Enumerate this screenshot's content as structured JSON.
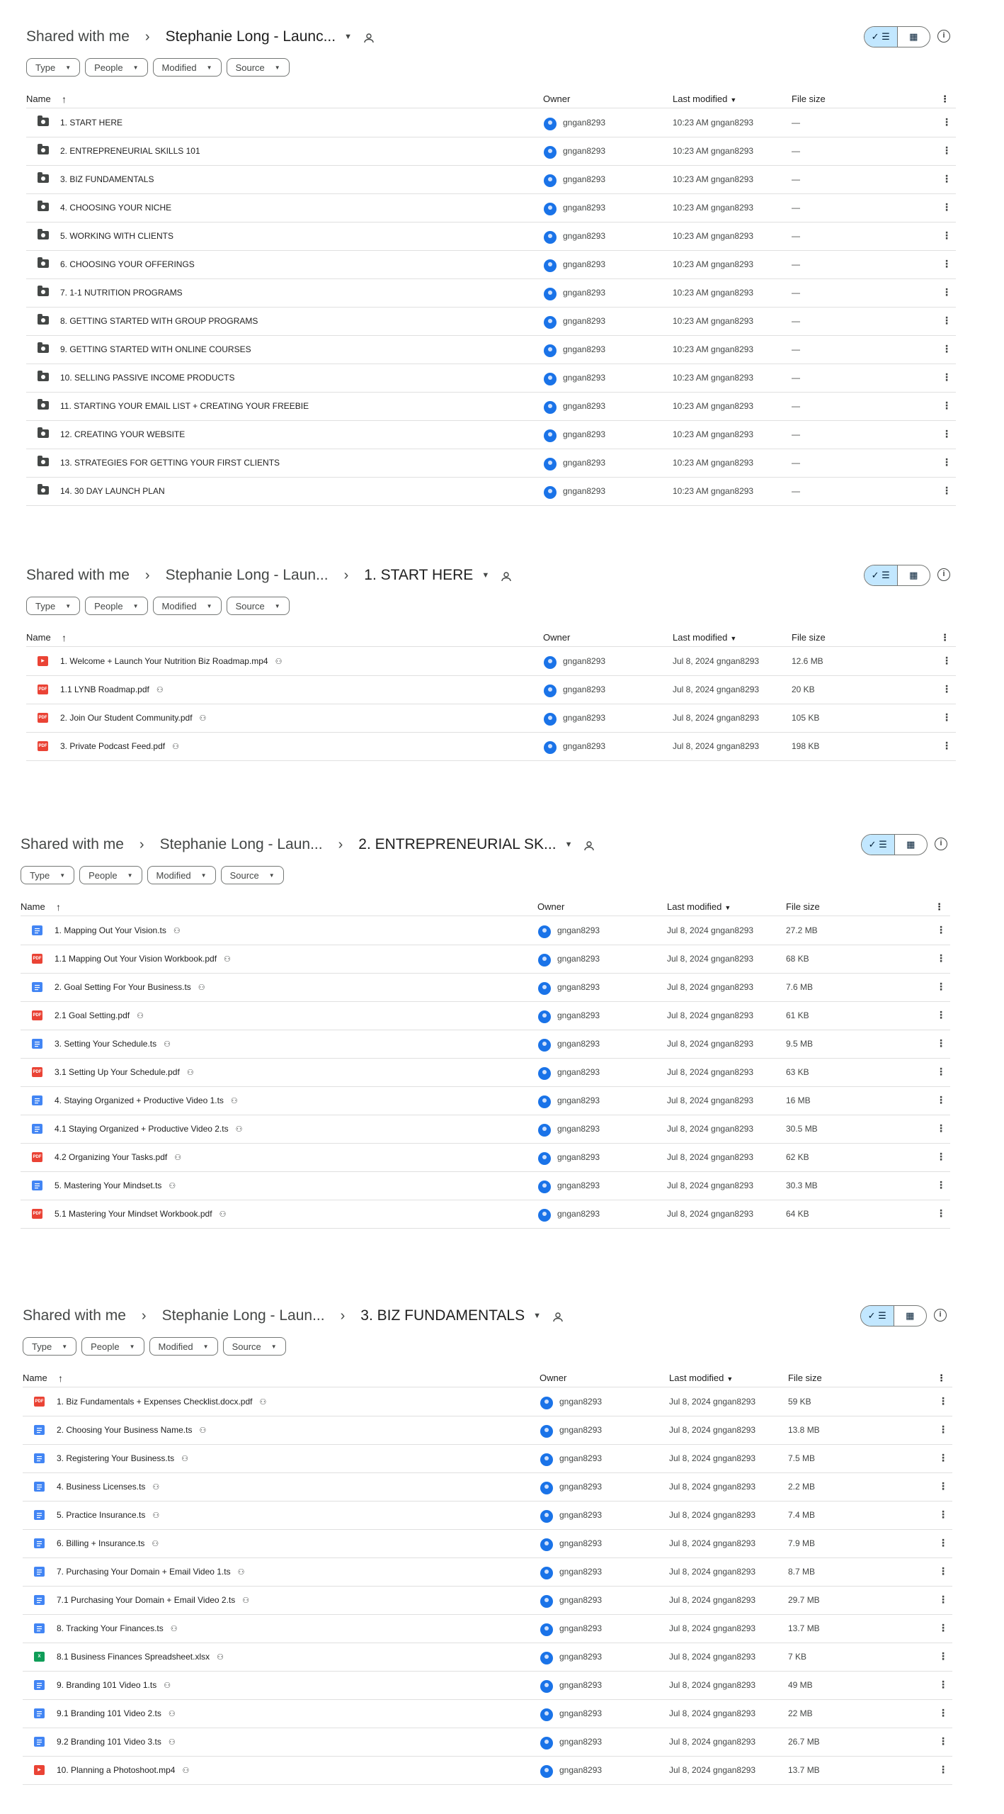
{
  "colors": {
    "accent": "#c2e7ff",
    "avatar": "#1a73e8",
    "pdf": "#ea4335",
    "video": "#ea4335",
    "doc": "#4285f4",
    "sheet": "#0f9d58",
    "folder": "#444746"
  },
  "columns": {
    "name": "Name",
    "owner": "Owner",
    "modified": "Last modified",
    "size": "File size"
  },
  "filters": [
    "Type",
    "People",
    "Modified",
    "Source"
  ],
  "panels": [
    {
      "crumbs": [
        "Shared with me",
        "Stephanie Long - Launc..."
      ],
      "rows": [
        {
          "name": "1. START HERE",
          "icon": "folder",
          "owner": "gngan8293",
          "modified": "10:23 AM gngan8293",
          "size": "—",
          "shared": false
        },
        {
          "name": "2. ENTREPRENEURIAL SKILLS 101",
          "icon": "folder",
          "owner": "gngan8293",
          "modified": "10:23 AM gngan8293",
          "size": "—",
          "shared": false
        },
        {
          "name": "3. BIZ FUNDAMENTALS",
          "icon": "folder",
          "owner": "gngan8293",
          "modified": "10:23 AM gngan8293",
          "size": "—",
          "shared": false
        },
        {
          "name": "4. CHOOSING YOUR NICHE",
          "icon": "folder",
          "owner": "gngan8293",
          "modified": "10:23 AM gngan8293",
          "size": "—",
          "shared": false
        },
        {
          "name": "5. WORKING WITH CLIENTS",
          "icon": "folder",
          "owner": "gngan8293",
          "modified": "10:23 AM gngan8293",
          "size": "—",
          "shared": false
        },
        {
          "name": "6. CHOOSING YOUR OFFERINGS",
          "icon": "folder",
          "owner": "gngan8293",
          "modified": "10:23 AM gngan8293",
          "size": "—",
          "shared": false
        },
        {
          "name": "7. 1-1 NUTRITION PROGRAMS",
          "icon": "folder",
          "owner": "gngan8293",
          "modified": "10:23 AM gngan8293",
          "size": "—",
          "shared": false
        },
        {
          "name": "8. GETTING STARTED WITH GROUP PROGRAMS",
          "icon": "folder",
          "owner": "gngan8293",
          "modified": "10:23 AM gngan8293",
          "size": "—",
          "shared": false
        },
        {
          "name": "9. GETTING STARTED WITH ONLINE COURSES",
          "icon": "folder",
          "owner": "gngan8293",
          "modified": "10:23 AM gngan8293",
          "size": "—",
          "shared": false
        },
        {
          "name": "10. SELLING PASSIVE INCOME PRODUCTS",
          "icon": "folder",
          "owner": "gngan8293",
          "modified": "10:23 AM gngan8293",
          "size": "—",
          "shared": false
        },
        {
          "name": "11. STARTING YOUR EMAIL LIST + CREATING YOUR FREEBIE",
          "icon": "folder",
          "owner": "gngan8293",
          "modified": "10:23 AM gngan8293",
          "size": "—",
          "shared": false
        },
        {
          "name": "12. CREATING YOUR WEBSITE",
          "icon": "folder",
          "owner": "gngan8293",
          "modified": "10:23 AM gngan8293",
          "size": "—",
          "shared": false
        },
        {
          "name": "13. STRATEGIES FOR GETTING YOUR FIRST CLIENTS",
          "icon": "folder",
          "owner": "gngan8293",
          "modified": "10:23 AM gngan8293",
          "size": "—",
          "shared": false
        },
        {
          "name": "14. 30 DAY LAUNCH PLAN",
          "icon": "folder",
          "owner": "gngan8293",
          "modified": "10:23 AM gngan8293",
          "size": "—",
          "shared": false
        }
      ]
    },
    {
      "crumbs": [
        "Shared with me",
        "Stephanie Long - Laun...",
        "1. START HERE"
      ],
      "rows": [
        {
          "name": "1. Welcome + Launch Your Nutrition Biz Roadmap.mp4",
          "icon": "video",
          "owner": "gngan8293",
          "modified": "Jul 8, 2024 gngan8293",
          "size": "12.6 MB",
          "shared": true
        },
        {
          "name": "1.1 LYNB Roadmap.pdf",
          "icon": "pdf",
          "owner": "gngan8293",
          "modified": "Jul 8, 2024 gngan8293",
          "size": "20 KB",
          "shared": true
        },
        {
          "name": "2. Join Our Student Community.pdf",
          "icon": "pdf",
          "owner": "gngan8293",
          "modified": "Jul 8, 2024 gngan8293",
          "size": "105 KB",
          "shared": true
        },
        {
          "name": "3. Private Podcast Feed.pdf",
          "icon": "pdf",
          "owner": "gngan8293",
          "modified": "Jul 8, 2024 gngan8293",
          "size": "198 KB",
          "shared": true
        }
      ]
    },
    {
      "crumbs": [
        "Shared with me",
        "Stephanie Long - Laun...",
        "2. ENTREPRENEURIAL SK..."
      ],
      "rows": [
        {
          "name": "1. Mapping Out Your Vision.ts",
          "icon": "doc",
          "owner": "gngan8293",
          "modified": "Jul 8, 2024 gngan8293",
          "size": "27.2 MB",
          "shared": true
        },
        {
          "name": "1.1 Mapping Out Your Vision Workbook.pdf",
          "icon": "pdf",
          "owner": "gngan8293",
          "modified": "Jul 8, 2024 gngan8293",
          "size": "68 KB",
          "shared": true
        },
        {
          "name": "2. Goal Setting For Your Business.ts",
          "icon": "doc",
          "owner": "gngan8293",
          "modified": "Jul 8, 2024 gngan8293",
          "size": "7.6 MB",
          "shared": true
        },
        {
          "name": "2.1 Goal Setting.pdf",
          "icon": "pdf",
          "owner": "gngan8293",
          "modified": "Jul 8, 2024 gngan8293",
          "size": "61 KB",
          "shared": true
        },
        {
          "name": "3. Setting Your Schedule.ts",
          "icon": "doc",
          "owner": "gngan8293",
          "modified": "Jul 8, 2024 gngan8293",
          "size": "9.5 MB",
          "shared": true
        },
        {
          "name": "3.1 Setting Up Your Schedule.pdf",
          "icon": "pdf",
          "owner": "gngan8293",
          "modified": "Jul 8, 2024 gngan8293",
          "size": "63 KB",
          "shared": true
        },
        {
          "name": "4. Staying Organized + Productive Video 1.ts",
          "icon": "doc",
          "owner": "gngan8293",
          "modified": "Jul 8, 2024 gngan8293",
          "size": "16 MB",
          "shared": true
        },
        {
          "name": "4.1 Staying Organized + Productive Video 2.ts",
          "icon": "doc",
          "owner": "gngan8293",
          "modified": "Jul 8, 2024 gngan8293",
          "size": "30.5 MB",
          "shared": true
        },
        {
          "name": "4.2 Organizing Your Tasks.pdf",
          "icon": "pdf",
          "owner": "gngan8293",
          "modified": "Jul 8, 2024 gngan8293",
          "size": "62 KB",
          "shared": true
        },
        {
          "name": "5. Mastering Your Mindset.ts",
          "icon": "doc",
          "owner": "gngan8293",
          "modified": "Jul 8, 2024 gngan8293",
          "size": "30.3 MB",
          "shared": true
        },
        {
          "name": "5.1 Mastering Your Mindset Workbook.pdf",
          "icon": "pdf",
          "owner": "gngan8293",
          "modified": "Jul 8, 2024 gngan8293",
          "size": "64 KB",
          "shared": true
        }
      ]
    },
    {
      "crumbs": [
        "Shared with me",
        "Stephanie Long - Laun...",
        "3. BIZ FUNDAMENTALS"
      ],
      "rows": [
        {
          "name": "1. Biz Fundamentals + Expenses Checklist.docx.pdf",
          "icon": "pdf",
          "owner": "gngan8293",
          "modified": "Jul 8, 2024 gngan8293",
          "size": "59 KB",
          "shared": true
        },
        {
          "name": "2. Choosing Your Business Name.ts",
          "icon": "doc",
          "owner": "gngan8293",
          "modified": "Jul 8, 2024 gngan8293",
          "size": "13.8 MB",
          "shared": true
        },
        {
          "name": "3. Registering Your Business.ts",
          "icon": "doc",
          "owner": "gngan8293",
          "modified": "Jul 8, 2024 gngan8293",
          "size": "7.5 MB",
          "shared": true
        },
        {
          "name": "4. Business Licenses.ts",
          "icon": "doc",
          "owner": "gngan8293",
          "modified": "Jul 8, 2024 gngan8293",
          "size": "2.2 MB",
          "shared": true
        },
        {
          "name": "5. Practice Insurance.ts",
          "icon": "doc",
          "owner": "gngan8293",
          "modified": "Jul 8, 2024 gngan8293",
          "size": "7.4 MB",
          "shared": true
        },
        {
          "name": "6. Billing + Insurance.ts",
          "icon": "doc",
          "owner": "gngan8293",
          "modified": "Jul 8, 2024 gngan8293",
          "size": "7.9 MB",
          "shared": true
        },
        {
          "name": "7. Purchasing Your Domain + Email Video 1.ts",
          "icon": "doc",
          "owner": "gngan8293",
          "modified": "Jul 8, 2024 gngan8293",
          "size": "8.7 MB",
          "shared": true
        },
        {
          "name": "7.1 Purchasing Your Domain + Email Video 2.ts",
          "icon": "doc",
          "owner": "gngan8293",
          "modified": "Jul 8, 2024 gngan8293",
          "size": "29.7 MB",
          "shared": true
        },
        {
          "name": "8. Tracking Your Finances.ts",
          "icon": "doc",
          "owner": "gngan8293",
          "modified": "Jul 8, 2024 gngan8293",
          "size": "13.7 MB",
          "shared": true
        },
        {
          "name": "8.1 Business Finances Spreadsheet.xlsx",
          "icon": "sheet",
          "owner": "gngan8293",
          "modified": "Jul 8, 2024 gngan8293",
          "size": "7 KB",
          "shared": true
        },
        {
          "name": "9. Branding 101 Video 1.ts",
          "icon": "doc",
          "owner": "gngan8293",
          "modified": "Jul 8, 2024 gngan8293",
          "size": "49 MB",
          "shared": true
        },
        {
          "name": "9.1 Branding 101 Video 2.ts",
          "icon": "doc",
          "owner": "gngan8293",
          "modified": "Jul 8, 2024 gngan8293",
          "size": "22 MB",
          "shared": true
        },
        {
          "name": "9.2 Branding 101 Video 3.ts",
          "icon": "doc",
          "owner": "gngan8293",
          "modified": "Jul 8, 2024 gngan8293",
          "size": "26.7 MB",
          "shared": true
        },
        {
          "name": "10. Planning a Photoshoot.mp4",
          "icon": "video",
          "owner": "gngan8293",
          "modified": "Jul 8, 2024 gngan8293",
          "size": "13.7 MB",
          "shared": true
        }
      ]
    }
  ]
}
